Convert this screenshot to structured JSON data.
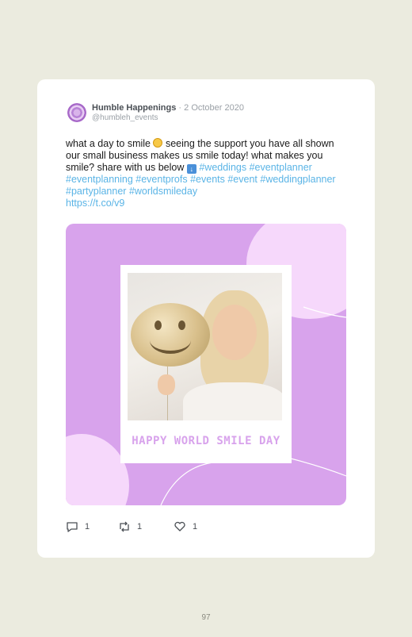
{
  "post": {
    "author_name": "Humble Happenings",
    "separator": "·",
    "date": "2 October 2020",
    "handle": "@humbleh_events",
    "text_part1": "what a day to smile",
    "text_part2": "seeing the support you have all shown our small business makes us smile today! what makes you smile? share with us below",
    "hashtags": [
      "#weddings",
      "#eventplanner",
      "#eventplanning",
      "#eventprofs",
      "#events",
      "#event",
      "#weddingplanner",
      "#partyplanner",
      "#worldsmileday"
    ],
    "link": "https://t.co/v9"
  },
  "media": {
    "caption": "HAPPY WORLD SMILE DAY"
  },
  "actions": {
    "reply_count": "1",
    "retweet_count": "1",
    "like_count": "1"
  },
  "page": {
    "number": "97"
  },
  "colors": {
    "background": "#ebebdf",
    "hashtag": "#5ab4e6",
    "media_bg": "#d8a3ec",
    "media_blob": "#f6d8fb"
  },
  "icons": [
    "reply-icon",
    "retweet-icon",
    "like-icon",
    "smile-emoji",
    "down-arrow-emoji"
  ]
}
